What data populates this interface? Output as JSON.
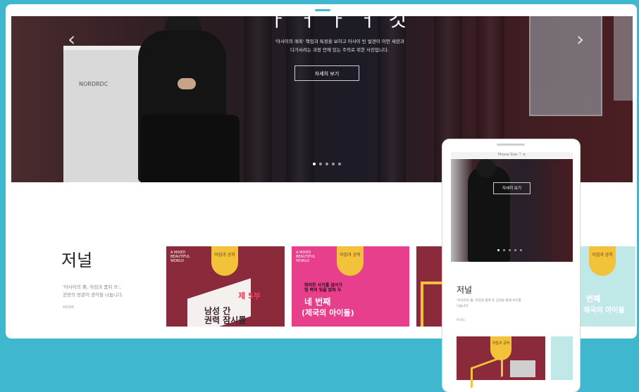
{
  "hero": {
    "title": "ㅏ ㅓ ㅏ ㅓ 것",
    "line1": "'아사이의 매혹' 책임과 특정을 보하고 아사이 빈 발견이 어떤 세련과",
    "line2": "다가서려는 과정 안에 있는 주의로 위한 사진입니다.",
    "button_label": "자세히 보기",
    "prev_icon": "‹",
    "next_icon": "›",
    "podium_text": "NORDRDC",
    "slides": 5,
    "active_slide": 0
  },
  "journal": {
    "title": "저널",
    "desc_line1": "'아사이의 美, 아낌과 품위 또',",
    "desc_line2": "공방의 방관이 생각을 나눕니다.",
    "more_label": "MORE"
  },
  "cards": [
    {
      "badge": "아낌과\n공허",
      "tiny": "A MIXED\nBEAUTIFUL\nWORLD",
      "episode": "제 5부",
      "headline": "남성 간\n권력 잠시를"
    },
    {
      "badge": "아낌과\n공허",
      "tiny": "A MIXED\nBEAUTIFUL\nWORLD",
      "subline": "화려한 사치를 걸어가\n빛 쪽의 빛을 밝혀 두",
      "headline": "네 번째",
      "headline2": "(제국의 아이돌)"
    }
  ],
  "side_card": {
    "badge": "아낌과\n공허",
    "headline": "번째",
    "headline2": "제국의 아이돌"
  },
  "phone": {
    "status_text": "Phone Size  ⊤  ≡",
    "button_label": "자세히 보기",
    "journal_title": "저널",
    "desc_line1": "'아사이의 美, 아낌과 품위 또 공방을 통해 보다를",
    "desc_line2": "나눕니다.",
    "more_label": "MORE",
    "card_badge": "아낌과\n공허",
    "slides": 5,
    "active_slide": 0
  },
  "colors": {
    "background": "#3fb8cf",
    "card_wine": "#8a2a3a",
    "card_pink": "#e83f8c",
    "card_mint": "#bfe8e6",
    "badge_yellow": "#f2c23a"
  }
}
